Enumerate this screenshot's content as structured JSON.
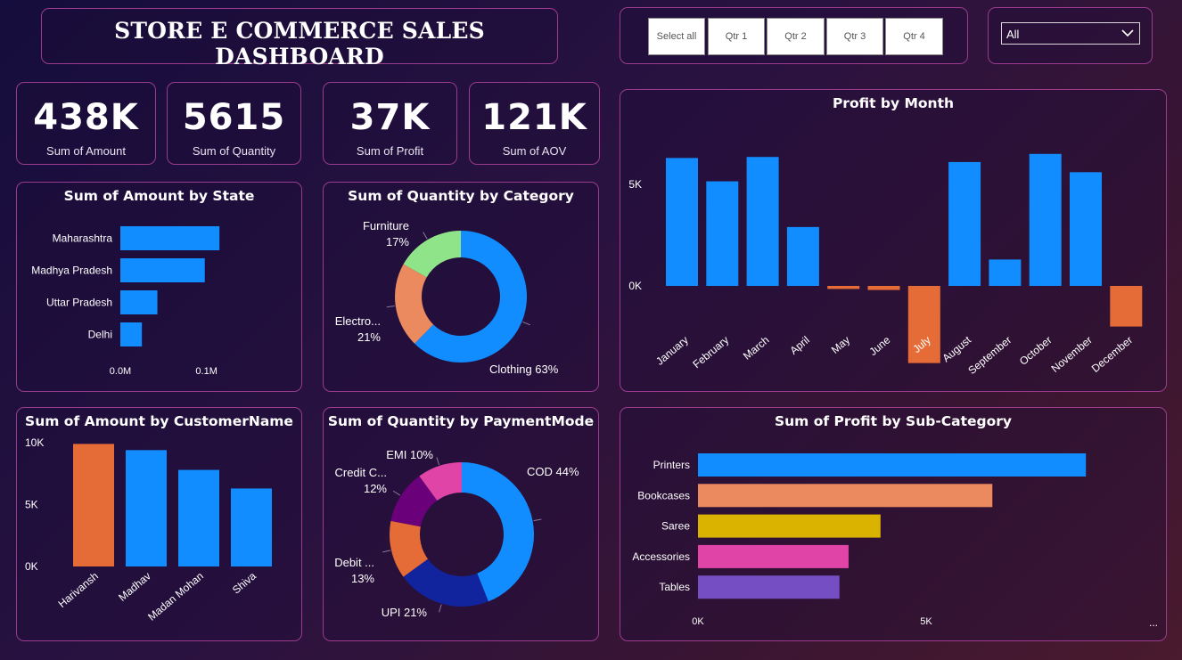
{
  "header": {
    "title": "STORE E COMMERCE SALES DASHBOARD"
  },
  "slicer": {
    "buttons": [
      "Select all",
      "Qtr 1",
      "Qtr 2",
      "Qtr 3",
      "Qtr 4"
    ]
  },
  "filter": {
    "selected": "All"
  },
  "kpis": [
    {
      "value": "438K",
      "label": "Sum of Amount"
    },
    {
      "value": "5615",
      "label": "Sum of Quantity"
    },
    {
      "value": "37K",
      "label": "Sum of Profit"
    },
    {
      "value": "121K",
      "label": "Sum of AOV"
    }
  ],
  "colors": {
    "blue": "#118dff",
    "orange": "#e66c37",
    "salmon": "#eb895f",
    "green": "#8fe388",
    "gold": "#d9b300",
    "pink": "#e044a7",
    "purple": "#744ec2",
    "darkblue": "#12239e",
    "violet": "#6b007b"
  },
  "chart_data": [
    {
      "id": "amount_by_state",
      "type": "bar",
      "orientation": "horizontal",
      "title": "Sum of Amount by State",
      "categories": [
        "Maharashtra",
        "Madhya Pradesh",
        "Uttar Pradesh",
        "Delhi"
      ],
      "values": [
        0.115,
        0.098,
        0.043,
        0.025
      ],
      "xlim": [
        0,
        0.12
      ],
      "xticks": [
        "0.0M",
        "0.1M"
      ],
      "color": "#118dff"
    },
    {
      "id": "quantity_by_category",
      "type": "pie",
      "donut": true,
      "title": "Sum of Quantity by Category",
      "slices": [
        {
          "label": "Clothing",
          "value": 63,
          "display": "Clothing 63%",
          "color": "#118dff"
        },
        {
          "label": "Electro...",
          "value": 21,
          "display": "21%",
          "color": "#eb895f"
        },
        {
          "label": "Furniture",
          "value": 17,
          "display": "17%",
          "color": "#8fe388"
        }
      ]
    },
    {
      "id": "profit_by_month",
      "type": "bar",
      "title": "Profit by Month",
      "categories": [
        "January",
        "February",
        "March",
        "April",
        "May",
        "June",
        "July",
        "August",
        "September",
        "October",
        "November",
        "December"
      ],
      "values": [
        6300,
        5150,
        6350,
        2900,
        -150,
        -200,
        -3800,
        6100,
        1300,
        6500,
        5600,
        -2000
      ],
      "ylim": [
        -5500,
        7500
      ],
      "yticks": [
        "5K",
        "0K"
      ],
      "pos_color": "#118dff",
      "neg_color": "#e66c37"
    },
    {
      "id": "amount_by_customer",
      "type": "bar",
      "title": "Sum of Amount by CustomerName",
      "categories": [
        "Harivansh",
        "Madhav",
        "Madan Mohan",
        "Shiva"
      ],
      "values": [
        9900,
        9400,
        7800,
        6300
      ],
      "ylim": [
        0,
        10000
      ],
      "yticks": [
        "10K",
        "5K",
        "0K"
      ],
      "highlight_color": "#e66c37",
      "color": "#118dff"
    },
    {
      "id": "quantity_by_paymentmode",
      "type": "pie",
      "donut": true,
      "title": "Sum of Quantity by PaymentMode",
      "slices": [
        {
          "label": "COD",
          "value": 44,
          "display": "COD 44%",
          "color": "#118dff"
        },
        {
          "label": "UPI",
          "value": 21,
          "display": "UPI 21%",
          "color": "#12239e"
        },
        {
          "label": "Debit ...",
          "value": 13,
          "display": "13%",
          "color": "#e66c37"
        },
        {
          "label": "Credit C...",
          "value": 12,
          "display": "12%",
          "color": "#6b007b"
        },
        {
          "label": "EMI",
          "value": 10,
          "display": "EMI 10%",
          "color": "#e044a7"
        }
      ]
    },
    {
      "id": "profit_by_subcategory",
      "type": "bar",
      "orientation": "horizontal",
      "title": "Sum of Profit by Sub-Category",
      "categories": [
        "Printers",
        "Bookcases",
        "Saree",
        "Accessories",
        "Tables"
      ],
      "values": [
        8500,
        6450,
        4000,
        3300,
        3100
      ],
      "xlim": [
        0,
        10000
      ],
      "xticks": [
        "0K",
        "5K"
      ],
      "more": "...",
      "colors": [
        "#118dff",
        "#eb895f",
        "#d9b300",
        "#e044a7",
        "#744ec2"
      ]
    }
  ]
}
